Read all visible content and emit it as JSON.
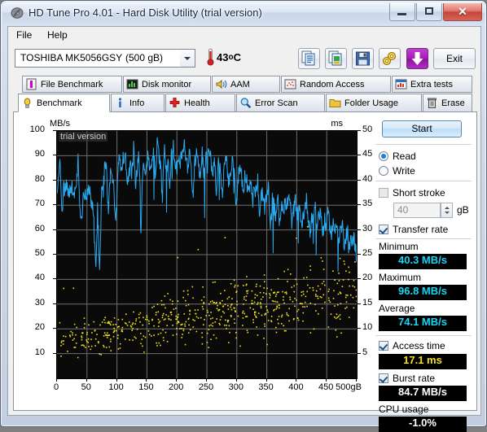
{
  "window": {
    "title": "HD Tune Pro 4.01 - Hard Disk Utility (trial version)",
    "app_icon": "hdd-icon",
    "minimize_label": "",
    "maximize_label": "",
    "close_label": "✕"
  },
  "menu": [
    {
      "label": "File",
      "accel": "F"
    },
    {
      "label": "Help",
      "accel": "H"
    }
  ],
  "toolbar": {
    "drive": {
      "name": "TOSHIBA MK5056GSY",
      "capacity": "(500 gB)"
    },
    "temperature": {
      "value": "43",
      "degree": "o",
      "unit": "C"
    },
    "buttons": [
      {
        "name": "copy-icon"
      },
      {
        "name": "copy-image-icon"
      },
      {
        "name": "save-icon"
      },
      {
        "name": "settings-icon"
      },
      {
        "name": "download-icon"
      }
    ],
    "exit_label": "Exit"
  },
  "tabs": {
    "row1": [
      {
        "label": "File Benchmark",
        "icon": "file-benchmark-icon",
        "active": false
      },
      {
        "label": "Disk monitor",
        "icon": "bar-chart-icon",
        "active": false
      },
      {
        "label": "AAM",
        "icon": "speaker-icon",
        "active": false
      },
      {
        "label": "Random Access",
        "icon": "scatter-icon",
        "active": false
      },
      {
        "label": "Extra tests",
        "icon": "bar-chart-icon",
        "active": false
      }
    ],
    "row2": [
      {
        "label": "Benchmark",
        "icon": "bulb-icon",
        "active": true
      },
      {
        "label": "Info",
        "icon": "info-icon",
        "active": false
      },
      {
        "label": "Health",
        "icon": "cross-icon",
        "active": false
      },
      {
        "label": "Error Scan",
        "icon": "magnifier-icon",
        "active": false
      },
      {
        "label": "Folder Usage",
        "icon": "folder-icon",
        "active": false
      },
      {
        "label": "Erase",
        "icon": "trash-icon",
        "active": false
      }
    ]
  },
  "panel": {
    "start_label": "Start",
    "mode": {
      "read_label": "Read",
      "write_label": "Write",
      "selected": "Read"
    },
    "short_stroke": {
      "label": "Short stroke",
      "checked": false,
      "value": "40",
      "unit": "gB"
    },
    "transfer_rate": {
      "label": "Transfer rate",
      "checked": true
    },
    "minimum": {
      "label": "Minimum",
      "value": "40.3 MB/s"
    },
    "maximum": {
      "label": "Maximum",
      "value": "96.8 MB/s"
    },
    "average": {
      "label": "Average",
      "value": "74.1 MB/s"
    },
    "access_time": {
      "label": "Access time",
      "checked": true,
      "value": "17.1 ms"
    },
    "burst_rate": {
      "label": "Burst rate",
      "checked": true,
      "value": "84.7 MB/s"
    },
    "cpu_usage": {
      "label": "CPU usage",
      "value": "-1.0%"
    }
  },
  "chart_data": {
    "type": "line",
    "title": "",
    "watermark": "trial version",
    "xlabel": "",
    "ylabel": "MB/s",
    "y2label": "ms",
    "xlim": [
      0,
      500
    ],
    "ylim": [
      0,
      100
    ],
    "y2lim": [
      0,
      50
    ],
    "x_unit_suffix": "gB",
    "grid": true,
    "legend": "none",
    "xticks": [
      0,
      50,
      100,
      150,
      200,
      250,
      300,
      350,
      400,
      450,
      500
    ],
    "xticklabels": [
      "0",
      "50",
      "100",
      "150",
      "200",
      "250",
      "300",
      "350",
      "400",
      "450",
      "500gB"
    ],
    "yticks": [
      10,
      20,
      30,
      40,
      50,
      60,
      70,
      80,
      90,
      100
    ],
    "y2ticks": [
      5,
      10,
      15,
      20,
      25,
      30,
      35,
      40,
      45,
      50
    ],
    "colors": {
      "transfer_rate": "#2aaaf0",
      "access_time": "#f2e21a",
      "plot_bg": "#0a0a0a",
      "grid": "#6f6f6f"
    },
    "series": [
      {
        "name": "Transfer rate",
        "axis": "left",
        "unit": "MB/s",
        "color": "#2aaaf0",
        "x": [
          2,
          5,
          8,
          11,
          14,
          17,
          20,
          23,
          26,
          29,
          32,
          35,
          38,
          41,
          44,
          47,
          50,
          53,
          56,
          59,
          62,
          65,
          68,
          71,
          74,
          77,
          80,
          83,
          86,
          89,
          92,
          95,
          98,
          101,
          104,
          107,
          110,
          113,
          116,
          119,
          122,
          125,
          128,
          131,
          134,
          137,
          140,
          143,
          146,
          149,
          152,
          155,
          158,
          161,
          164,
          167,
          170,
          173,
          176,
          179,
          182,
          185,
          188,
          191,
          194,
          197,
          200,
          203,
          206,
          209,
          212,
          215,
          218,
          221,
          224,
          227,
          230,
          233,
          236,
          239,
          242,
          245,
          248,
          251,
          254,
          257,
          260,
          263,
          266,
          269,
          272,
          275,
          278,
          281,
          284,
          287,
          290,
          293,
          296,
          299,
          302,
          305,
          308,
          311,
          314,
          317,
          320,
          323,
          326,
          329,
          332,
          335,
          338,
          341,
          344,
          347,
          350,
          353,
          356,
          359,
          362,
          365,
          368,
          371,
          374,
          377,
          380,
          383,
          386,
          389,
          392,
          395,
          398,
          401,
          404,
          407,
          410,
          413,
          416,
          419,
          422,
          425,
          428,
          431,
          434,
          437,
          440,
          443,
          446,
          449,
          452,
          455,
          458,
          461,
          464,
          467,
          470,
          473,
          476,
          479,
          482,
          485,
          488,
          491,
          494,
          497,
          500
        ],
        "y": [
          78,
          92,
          66,
          77,
          76,
          78,
          74,
          76,
          77,
          76,
          75,
          90,
          72,
          62,
          78,
          74,
          72,
          78,
          73,
          71,
          66,
          42,
          71,
          40,
          74,
          76,
          87,
          82,
          67,
          84,
          81,
          77,
          60,
          83,
          88,
          87,
          88,
          91,
          84,
          78,
          88,
          82,
          93,
          78,
          85,
          91,
          60,
          85,
          87,
          82,
          92,
          84,
          88,
          93,
          82,
          95,
          90,
          84,
          74,
          92,
          85,
          87,
          78,
          91,
          95,
          86,
          84,
          90,
          88,
          92,
          96,
          88,
          86,
          90,
          84,
          74,
          87,
          94,
          88,
          80,
          92,
          84,
          90,
          86,
          94,
          88,
          82,
          90,
          74,
          86,
          88,
          72,
          84,
          90,
          86,
          78,
          82,
          88,
          84,
          70,
          80,
          86,
          82,
          74,
          84,
          79,
          76,
          82,
          70,
          78,
          75,
          80,
          62,
          76,
          72,
          68,
          74,
          77,
          59,
          72,
          70,
          66,
          74,
          62,
          70,
          66,
          72,
          68,
          74,
          70,
          63,
          68,
          72,
          66,
          70,
          62,
          65,
          68,
          72,
          66,
          60,
          64,
          67,
          70,
          62,
          66,
          68,
          58,
          64,
          61,
          66,
          63,
          58,
          62,
          60,
          65,
          57,
          60,
          62,
          55,
          58,
          60,
          52,
          56,
          58,
          54,
          50,
          48,
          41
        ]
      },
      {
        "name": "Access time",
        "axis": "right",
        "unit": "ms",
        "color": "#f2e21a",
        "scatter": true,
        "description": "Scatter cloud of ~600 samples rising from ~5-12 ms near 0 gB to ~15-25 ms near 500 gB, mean 17.1 ms"
      }
    ]
  }
}
